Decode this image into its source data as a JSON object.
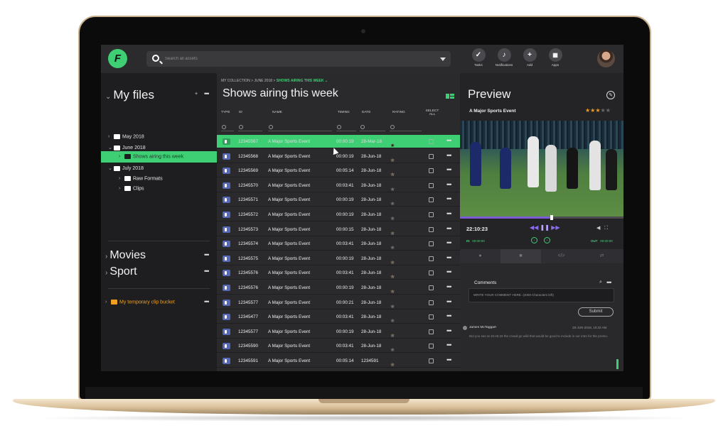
{
  "search": {
    "placeholder": "Search all assets"
  },
  "tools": [
    {
      "label": "Tasks",
      "icon": "check-icon"
    },
    {
      "label": "Notifications",
      "icon": "bell-icon"
    },
    {
      "label": "Add",
      "icon": "plus-icon"
    },
    {
      "label": "Apps",
      "icon": "grid-icon"
    }
  ],
  "sidebar": {
    "my_files": "My files",
    "folders": [
      "May 2018",
      "June 2018",
      "Shows airing this week",
      "July 2018",
      "Raw Formats",
      "Clips"
    ],
    "movies": "Movies",
    "sport": "Sport",
    "bucket": "My temporary clip bucket",
    "colors": {
      "accent": "#3ecf74",
      "bucket": "#f0a020"
    }
  },
  "main": {
    "breadcrumb": [
      "MY COLLECTION",
      "JUNE 2018",
      "SHOWS AIRING THIS WEEK"
    ],
    "title": "Shows airing this week",
    "columns": [
      "TYPE",
      "ID",
      "NAME",
      "TIMING",
      "DATE",
      "RATING",
      "SELECT ALL"
    ],
    "rows": [
      {
        "id": "12345567",
        "name": "A Major Sports Event",
        "timing": "00:00:19",
        "date": "28-Mar-18",
        "rating": 3,
        "active": true
      },
      {
        "id": "12345568",
        "name": "A Major Sports Event",
        "timing": "00:00:19",
        "date": "28-Jun-18",
        "rating": 3
      },
      {
        "id": "12345569",
        "name": "A Major Sports Event",
        "timing": "00:05:14",
        "date": "28-Jun-18",
        "rating": 3
      },
      {
        "id": "12345570",
        "name": "A Major Sports Event",
        "timing": "00:03:41",
        "date": "28-Jun-18",
        "rating": 1
      },
      {
        "id": "12345571",
        "name": "A Major Sports Event",
        "timing": "00:00:19",
        "date": "28-Jun-18",
        "rating": 1
      },
      {
        "id": "12345572",
        "name": "A Major Sports Event",
        "timing": "00:00:19",
        "date": "28-Jun-18",
        "rating": 2
      },
      {
        "id": "12345573",
        "name": "A Major Sports Event",
        "timing": "00:00:15",
        "date": "28-Jun-18",
        "rating": 3
      },
      {
        "id": "12345574",
        "name": "A Major Sports Event",
        "timing": "00:03:41",
        "date": "28-Jun-18",
        "rating": 1
      },
      {
        "id": "12345575",
        "name": "A Major Sports Event",
        "timing": "00:00:19",
        "date": "28-Jun-18",
        "rating": 3
      },
      {
        "id": "12345576",
        "name": "A Major Sports Event",
        "timing": "00:03:41",
        "date": "28-Jun-18",
        "rating": 3
      },
      {
        "id": "12345576",
        "name": "A Major Sports Event",
        "timing": "00:00:19",
        "date": "28-Jun-18",
        "rating": 3
      },
      {
        "id": "12345577",
        "name": "A Major Sports Event",
        "timing": "00:00:21",
        "date": "28-Jun-18",
        "rating": 2
      },
      {
        "id": "12345477",
        "name": "A Major Sports Event",
        "timing": "00:03:41",
        "date": "28-Jun-18",
        "rating": 1
      },
      {
        "id": "12345577",
        "name": "A Major Sports Event",
        "timing": "00:00:19",
        "date": "28-Jun-18",
        "rating": 3
      },
      {
        "id": "12345590",
        "name": "A Major Sports Event",
        "timing": "00:03:41",
        "date": "28-Jun-18",
        "rating": 1
      },
      {
        "id": "12345591",
        "name": "A Major Sports Event",
        "timing": "00:05:14",
        "date": "1234591",
        "rating": 3
      }
    ]
  },
  "preview": {
    "title": "Preview",
    "asset": "A Major Sports Event",
    "rating": 3,
    "timecode": "22:10:23",
    "progress": 0.56,
    "in_label": "IN",
    "in_time": "00:00:00",
    "out_label": "OUT",
    "out_time": "00:00:00",
    "tabs": [
      "info-icon",
      "comment-icon",
      "code-icon",
      "share-icon"
    ]
  },
  "comments": {
    "title": "Comments",
    "placeholder": "WRITE YOUR COMMENT HERE. (2000 Characters left)",
    "submit": "Submit",
    "user": "James McTaggart",
    "date": "28-JUN-2018, 10:32 AM",
    "text": "Did you see at 15:45:32 the crowd go wild that would be good to include in our intro for the promo."
  }
}
